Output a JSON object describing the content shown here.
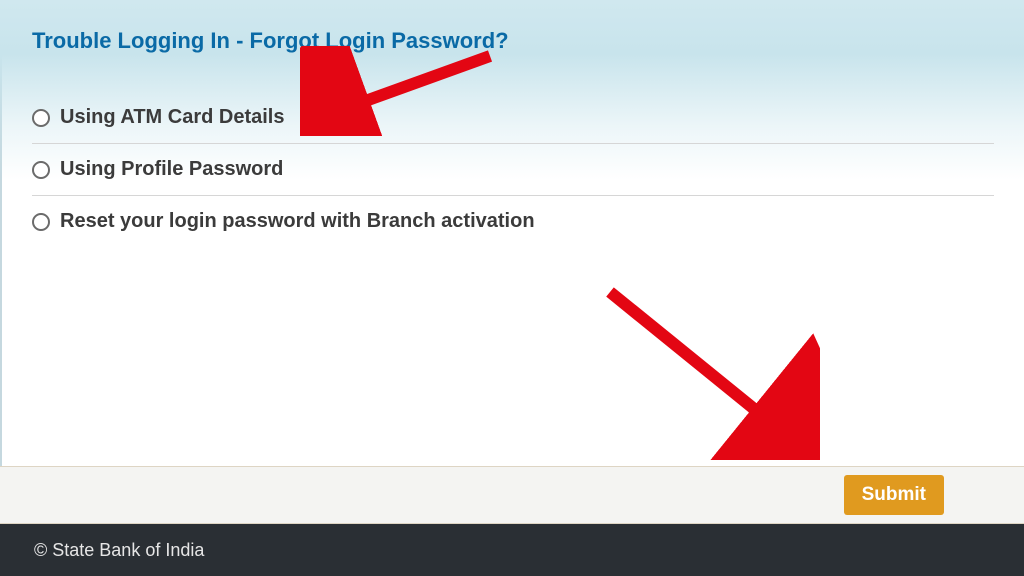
{
  "title": "Trouble Logging In - Forgot Login Password?",
  "options": [
    {
      "label": "Using ATM Card Details"
    },
    {
      "label": "Using Profile Password"
    },
    {
      "label": "Reset your login password with Branch activation"
    }
  ],
  "submit_label": "Submit",
  "footer_text": "© State Bank of India"
}
